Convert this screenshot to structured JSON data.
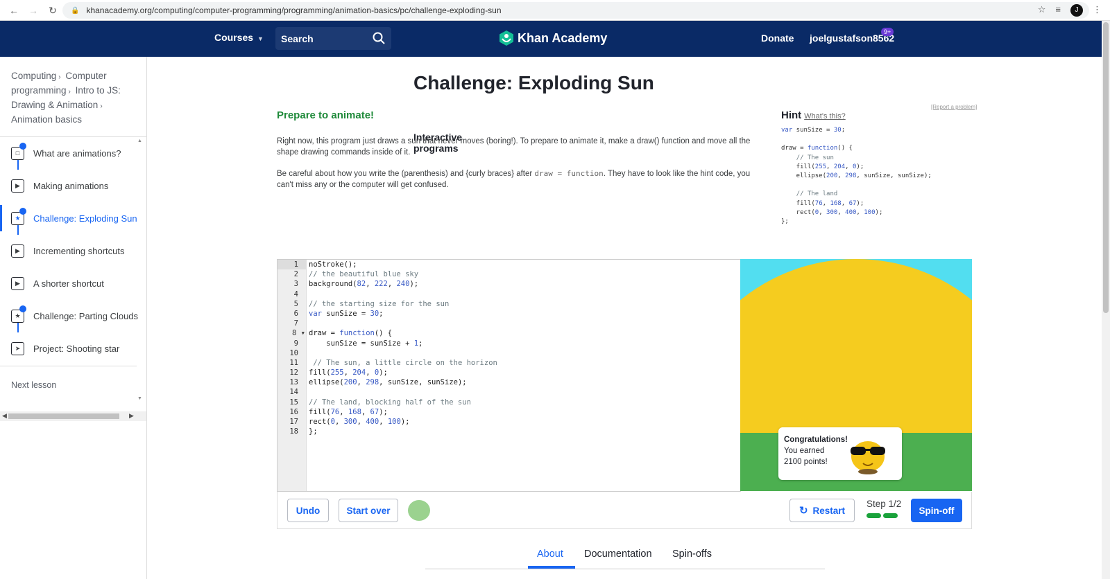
{
  "browser": {
    "url": "khanacademy.org/computing/computer-programming/programming/animation-basics/pc/challenge-exploding-sun",
    "profile_initial": "J"
  },
  "nav": {
    "courses": "Courses",
    "search": "Search",
    "logo": "Khan Academy",
    "donate": "Donate",
    "user": "joelgustafson8562",
    "badge": "9+"
  },
  "sidebar": {
    "breadcrumbs": [
      "Computing",
      "Computer programming",
      "Intro to JS: Drawing & Animation",
      "Animation basics"
    ],
    "lessons": [
      {
        "label": "What are animations?",
        "icon": "article-icon",
        "done": true
      },
      {
        "label": "Making animations",
        "icon": "play-icon",
        "done": false
      },
      {
        "label": "Challenge: Exploding Sun",
        "icon": "star-icon",
        "done": true,
        "active": true
      },
      {
        "label": "Incrementing shortcuts",
        "icon": "play-icon",
        "done": false
      },
      {
        "label": "A shorter shortcut",
        "icon": "play-icon",
        "done": false
      },
      {
        "label": "Challenge: Parting Clouds",
        "icon": "star-icon",
        "done": true
      },
      {
        "label": "Project: Shooting star",
        "icon": "rocket-icon",
        "done": false
      }
    ],
    "next_label": "Next lesson",
    "next_title": "Interactive programs"
  },
  "main": {
    "title": "Challenge: Exploding Sun",
    "subtitle": "Prepare to animate!",
    "para1": "Right now, this program just draws a sun that never moves (boring!). To prepare to animate it, make a draw() function and move all the shape drawing commands inside of it.",
    "para2_a": "Be careful about how you write the (parenthesis) and {curly braces} after",
    "para2_code": "draw = function",
    "para2_b": ". They have to look like the hint code, you can't miss any or the computer will get confused.",
    "hint_title": "Hint",
    "hint_what": "What's this?",
    "report": "[Report a problem]"
  },
  "hint_code": [
    "var sunSize = 30;",
    "",
    "draw = function() {",
    "    // The sun",
    "    fill(255, 204, 0);",
    "    ellipse(200, 298, sunSize, sunSize);",
    "",
    "    // The land",
    "    fill(76, 168, 67);",
    "    rect(0, 300, 400, 100);",
    "};"
  ],
  "editor": {
    "lines": [
      "noStroke();",
      "// the beautiful blue sky",
      "background(82, 222, 240);",
      "",
      "// the starting size for the sun",
      "var sunSize = 30;",
      "",
      "draw = function() {",
      "    sunSize = sunSize + 1;",
      "",
      " // The sun, a little circle on the horizon",
      "fill(255, 204, 0);",
      "ellipse(200, 298, sunSize, sunSize);",
      "",
      "// The land, blocking half of the sun",
      "fill(76, 168, 67);",
      "rect(0, 300, 400, 100);",
      "};"
    ]
  },
  "congrats": {
    "title": "Congratulations!",
    "line1": "You earned",
    "line2": "2100 points!"
  },
  "toolbar": {
    "undo": "Undo",
    "start_over": "Start over",
    "restart": "Restart",
    "step": "Step 1/2",
    "spinoff": "Spin-off"
  },
  "tabs": [
    "About",
    "Documentation",
    "Spin-offs"
  ],
  "colors": {
    "navy": "#0a2a66",
    "accent": "#1865f2",
    "sky": "#52def0",
    "sun": "#f5cc1f",
    "land": "#4caf50"
  }
}
